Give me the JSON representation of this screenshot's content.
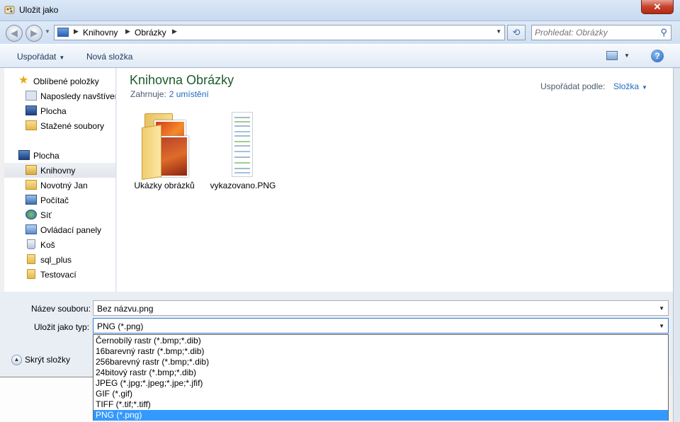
{
  "window": {
    "title": "Uložit jako",
    "close_label": "✕"
  },
  "nav": {
    "back_glyph": "◀",
    "forward_glyph": "▶",
    "breadcrumb": [
      "Knihovny",
      "Obrázky"
    ],
    "search_placeholder": "Prohledat: Obrázky"
  },
  "toolbar": {
    "organize_label": "Uspořádat",
    "new_folder_label": "Nová složka",
    "help_label": "?"
  },
  "sidebar": {
    "items": [
      {
        "label": "Oblíbené položky",
        "icon": "star-icon"
      },
      {
        "label": "Naposledy navštívené",
        "icon": "recent-places-icon"
      },
      {
        "label": "Plocha",
        "icon": "desktop-icon"
      },
      {
        "label": "Stažené soubory",
        "icon": "downloads-icon"
      },
      {
        "label": "Plocha",
        "icon": "desktop-icon"
      },
      {
        "label": "Knihovny",
        "icon": "libraries-icon",
        "selected": true
      },
      {
        "label": "Novotný Jan",
        "icon": "user-folder-icon"
      },
      {
        "label": "Počítač",
        "icon": "computer-icon"
      },
      {
        "label": "Síť",
        "icon": "network-icon"
      },
      {
        "label": "Ovládací panely",
        "icon": "control-panel-icon"
      },
      {
        "label": "Koš",
        "icon": "recycle-bin-icon"
      },
      {
        "label": "sql_plus",
        "icon": "folder-icon"
      },
      {
        "label": "Testovací",
        "icon": "folder-icon"
      }
    ]
  },
  "content": {
    "library_title": "Knihovna Obrázky",
    "includes_label": "Zahrnuje:",
    "includes_link": "2 umístění",
    "arrange_label": "Uspořádat podle:",
    "arrange_value": "Složka",
    "files": [
      {
        "name": "Ukázky obrázků",
        "icon": "pictures-folder-icon"
      },
      {
        "name": "vykazovano.PNG",
        "icon": "png-thumbnail-icon"
      }
    ]
  },
  "form": {
    "filename_label": "Název souboru:",
    "filename_value": "Bez názvu.png",
    "filetype_label": "Uložit jako typ:",
    "filetype_value": "PNG (*.png)",
    "hide_folders_label": "Skrýt složky",
    "filetype_options": [
      "Černobílý rastr (*.bmp;*.dib)",
      "16barevný rastr (*.bmp;*.dib)",
      "256barevný rastr (*.bmp;*.dib)",
      "24bitový rastr (*.bmp;*.dib)",
      "JPEG (*.jpg;*.jpeg;*.jpe;*.jfif)",
      "GIF (*.gif)",
      "TIFF (*.tif;*.tiff)",
      "PNG (*.png)"
    ],
    "selected_option_index": 7
  },
  "colors": {
    "selection": "#3399ff",
    "library_title": "#1e5b2a",
    "link": "#1e6bc0"
  }
}
